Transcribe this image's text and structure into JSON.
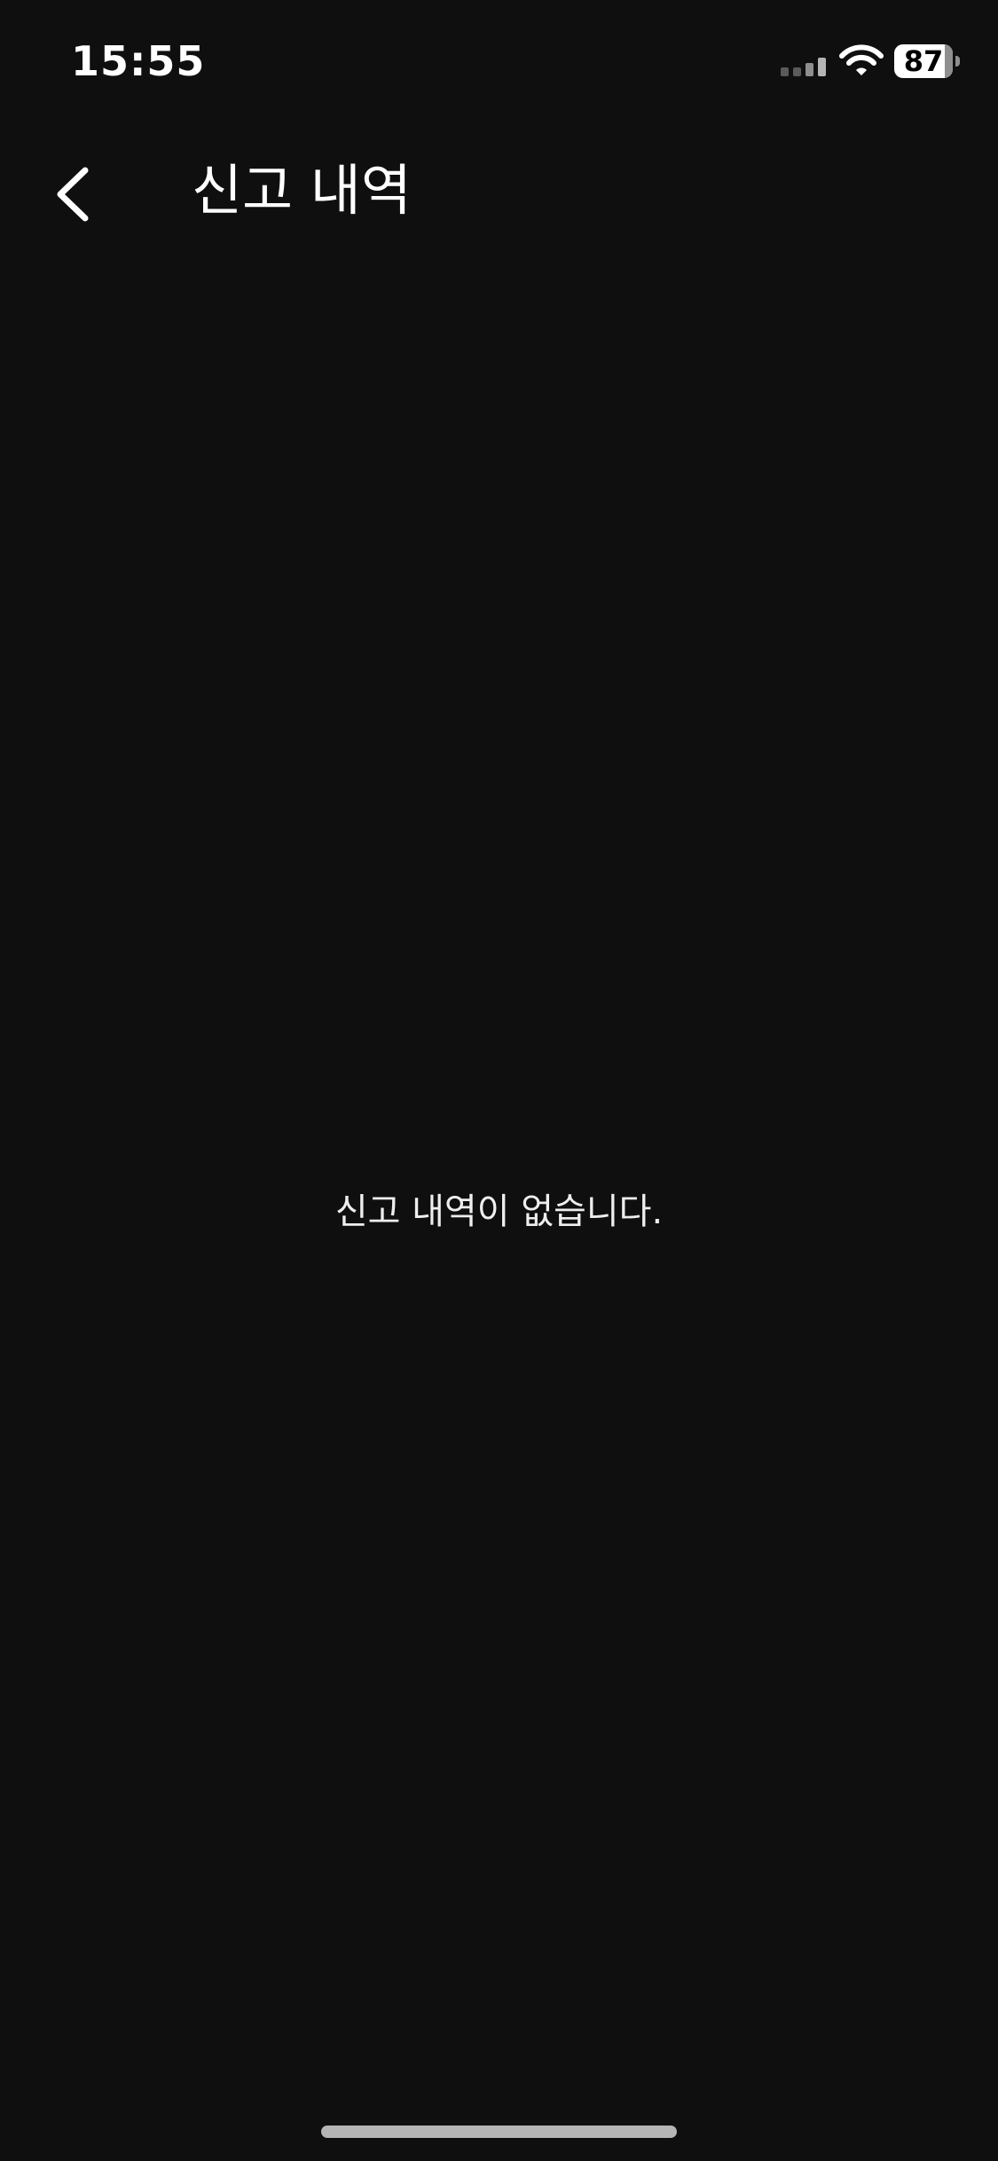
{
  "status_bar": {
    "time": "15:55",
    "battery_level": "87",
    "battery_fraction": 0.87,
    "signal_icon": "signal-bars-icon",
    "wifi_icon": "wifi-icon"
  },
  "header": {
    "back_icon": "chevron-left-icon",
    "title": "신고 내역"
  },
  "main": {
    "empty_message": "신고 내역이 없습니다."
  },
  "colors": {
    "background": "#0f0f0f",
    "text": "#ffffff",
    "home_indicator": "#b5b5b5"
  }
}
